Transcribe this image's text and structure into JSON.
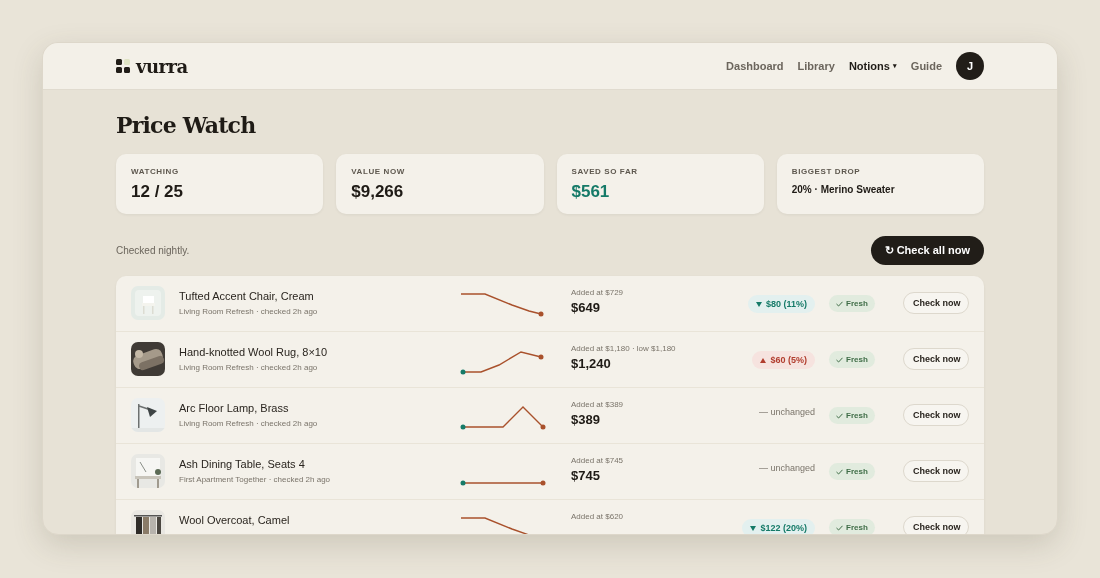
{
  "brand": "vurra",
  "nav": [
    {
      "label": "Dashboard",
      "selected": false
    },
    {
      "label": "Library",
      "selected": false
    },
    {
      "label": "Notions",
      "selected": true,
      "caret": "▾"
    },
    {
      "label": "Guide",
      "selected": false
    }
  ],
  "avatar": "J",
  "title": "Price Watch",
  "stats": [
    {
      "label": "WATCHING",
      "value": "12 / 25",
      "kind": "big"
    },
    {
      "label": "VALUE NOW",
      "value": "$9,266",
      "kind": "big"
    },
    {
      "label": "SAVED SO FAR",
      "value": "$561",
      "kind": "positive"
    },
    {
      "label": "BIGGEST DROP",
      "value": "20% · Merino Sweater",
      "kind": "small"
    }
  ],
  "note": "Checked nightly.",
  "check_all": {
    "icon": "↻",
    "label": "Check all now"
  },
  "items": [
    {
      "name": "Tufted Accent Chair, Cream",
      "meta": "Living Room Refresh · checked 2h ago",
      "added": "Added at $729",
      "price": "$649",
      "change": {
        "kind": "drop",
        "text": "$80 (11%)"
      },
      "status": "Fresh",
      "action": "Check now"
    },
    {
      "name": "Hand-knotted Wool Rug, 8×10",
      "meta": "Living Room Refresh · checked 2h ago",
      "added": "Added at $1,180 · low $1,180",
      "price": "$1,240",
      "change": {
        "kind": "rise",
        "text": "$60 (5%)"
      },
      "status": "Fresh",
      "action": "Check now"
    },
    {
      "name": "Arc Floor Lamp, Brass",
      "meta": "Living Room Refresh · checked 2h ago",
      "added": "Added at $389",
      "price": "$389",
      "change": {
        "kind": "none",
        "text": "— unchanged"
      },
      "status": "Fresh",
      "action": "Check now"
    },
    {
      "name": "Ash Dining Table, Seats 4",
      "meta": "First Apartment Together · checked 2h ago",
      "added": "Added at $745",
      "price": "$745",
      "change": {
        "kind": "none",
        "text": "— unchanged"
      },
      "status": "Fresh",
      "action": "Check now"
    },
    {
      "name": "Wool Overcoat, Camel",
      "added": "Added at $620",
      "change": {
        "kind": "drop",
        "text": "$122 (20%)"
      },
      "status": "Fresh",
      "action": "Check now"
    }
  ]
}
